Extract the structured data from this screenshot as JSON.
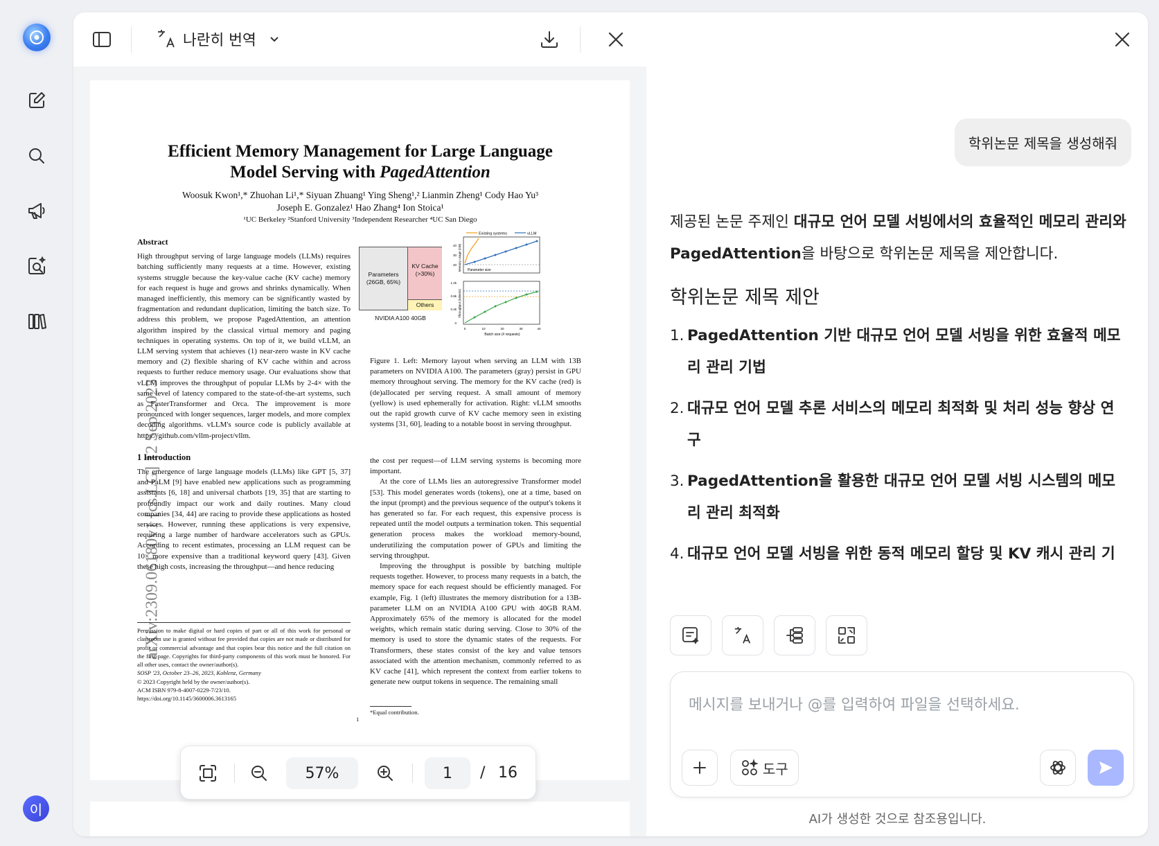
{
  "sidebar": {
    "icons": [
      "logo-icon",
      "new-chat-icon",
      "search-icon",
      "megaphone-icon",
      "image-search-icon",
      "library-icon"
    ],
    "avatar_label": "이"
  },
  "viewer": {
    "mode_label": "나란히 번역",
    "zoom": "57%",
    "current_page": "1",
    "page_separator": "/",
    "total_pages": "16"
  },
  "paper": {
    "title_line1": "Efficient Memory Management for Large Language",
    "title_line2a": "Model Serving with ",
    "title_line2b": "PagedAttention",
    "authors_line1": "Woosuk Kwon¹,* Zhuohan Li¹,* Siyuan Zhuang¹ Ying Sheng¹,² Lianmin Zheng¹ Cody Hao Yu³",
    "authors_line2": "Joseph E. Gonzalez¹ Hao Zhang⁴ Ion Stoica¹",
    "affiliations": "¹UC Berkeley ²Stanford University ³Independent Researcher ⁴UC San Diego",
    "arxiv_id": "arXiv:2309.06180v1 [cs.LG] 12 Sep 2023",
    "abstract_heading": "Abstract",
    "abstract_text": "High throughput serving of large language models (LLMs) requires batching sufficiently many requests at a time. However, existing systems struggle because the key-value cache (KV cache) memory for each request is huge and grows and shrinks dynamically. When managed inefficiently, this memory can be significantly wasted by fragmentation and redundant duplication, limiting the batch size. To address this problem, we propose PagedAttention, an attention algorithm inspired by the classical virtual memory and paging techniques in operating systems. On top of it, we build vLLM, an LLM serving system that achieves (1) near-zero waste in KV cache memory and (2) flexible sharing of KV cache within and across requests to further reduce memory usage. Our evaluations show that vLLM improves the throughput of popular LLMs by 2-4× with the same level of latency compared to the state-of-the-art systems, such as FasterTransformer and Orca. The improvement is more pronounced with longer sequences, larger models, and more complex decoding algorithms. vLLM's source code is publicly available at https://github.com/vllm-project/vllm.",
    "intro_heading": "1 Introduction",
    "intro_text": "The emergence of large language models (LLMs) like GPT [5, 37] and PaLM [9] have enabled new applications such as programming assistants [6, 18] and universal chatbots [19, 35] that are starting to profoundly impact our work and daily routines. Many cloud companies [34, 44] are racing to provide these applications as hosted services. However, running these applications is very expensive, requiring a large number of hardware accelerators such as GPUs. According to recent estimates, processing an LLM request can be 10× more expensive than a traditional keyword query [43]. Given these high costs, increasing the throughput—and hence reducing",
    "footnote_permission": "Permission to make digital or hard copies of part or all of this work for personal or classroom use is granted without fee provided that copies are not made or distributed for profit or commercial advantage and that copies bear this notice and the full citation on the first page. Copyrights for third-party components of this work must be honored. For all other uses, contact the owner/author(s).",
    "footnote_venue": "SOSP '23, October 23–26, 2023, Koblenz, Germany",
    "footnote_copyright": "© 2023 Copyright held by the owner/author(s).",
    "footnote_isbn": "ACM ISBN 979-8-4007-0229-7/23/10.",
    "footnote_doi": "https://doi.org/10.1145/3600006.3613165",
    "figure_caption": "Figure 1. Left: Memory layout when serving an LLM with 13B parameters on NVIDIA A100. The parameters (gray) persist in GPU memory throughout serving. The memory for the KV cache (red) is (de)allocated per serving request. A small amount of memory (yellow) is used ephemerally for activation. Right: vLLM smooths out the rapid growth curve of KV cache memory seen in existing systems [31, 60], leading to a notable boost in serving throughput.",
    "right_col_text1": "the cost per request—of LLM serving systems is becoming more important.",
    "right_col_text2": "At the core of LLMs lies an autoregressive Transformer model [53]. This model generates words (tokens), one at a time, based on the input (prompt) and the previous sequence of the output's tokens it has generated so far. For each request, this expensive process is repeated until the model outputs a termination token. This sequential generation process makes the workload memory-bound, underutilizing the computation power of GPUs and limiting the serving throughput.",
    "right_col_text3": "Improving the throughput is possible by batching multiple requests together. However, to process many requests in a batch, the memory space for each request should be efficiently managed. For example, Fig. 1 (left) illustrates the memory distribution for a 13B-parameter LLM on an NVIDIA A100 GPU with 40GB RAM. Approximately 65% of the memory is allocated for the model weights, which remain static during serving. Close to 30% of the memory is used to store the dynamic states of the requests. For Transformers, these states consist of the key and value tensors associated with the attention mechanism, commonly referred to as KV cache [41], which represent the context from earlier tokens to generate new output tokens in sequence. The remaining small",
    "equal_contribution": "*Equal contribution.",
    "page_number": "1",
    "fig_params": "Parameters (26GB, 65%)",
    "fig_kv": "KV Cache (>30%)",
    "fig_others": "Others",
    "fig_gpu": "NVIDIA A100 40GB",
    "fig_legend_existing": "Existing systems",
    "fig_legend_vllm": "vLLM",
    "fig_memory_axis": "Memory usage (GB)",
    "fig_param_size": "Parameter size",
    "fig_throughput_axis": "Throughput (token/s)",
    "fig_batch_axis": "Batch size (# requests)",
    "fig_y_ticks_top": [
      "40",
      "30",
      "20"
    ],
    "fig_y_ticks_bottom": [
      "1.2k",
      "0.8k",
      "0.4k",
      "0"
    ],
    "fig_x_ticks": [
      "0",
      "10",
      "20",
      "30",
      "40"
    ]
  },
  "chat": {
    "user_message": "학위논문 제목을 생성해줘",
    "intro_plain1": "제공된 논문 주제인 ",
    "intro_bold": "대규모 언어 모델 서빙에서의 효율적인 메모리 관리와 PagedAttention",
    "intro_plain2": "을 바탕으로 학위논문 제목을 제안합니다.",
    "heading": "학위논문 제목 제안",
    "items": [
      {
        "num": "1.",
        "text": "PagedAttention 기반 대규모 언어 모델 서빙을 위한 효율적 메모리 관리 기법"
      },
      {
        "num": "2.",
        "text": "대규모 언어 모델 추론 서비스의 메모리 최적화 및 처리 성능 향상 연구"
      },
      {
        "num": "3.",
        "text": "PagedAttention을 활용한 대규모 언어 모델 서빙 시스템의 메모리 관리 최적화"
      },
      {
        "num": "4.",
        "text": "대규모 언어 모델 서빙을 위한 동적 메모리 할당 및 KV 캐시 관리 기법"
      }
    ],
    "input_placeholder": "메시지를 보내거나 @를 입력하여 파일을 선택하세요.",
    "tools_label": "도구",
    "disclaimer": "AI가 생성한 것으로 참조용입니다."
  },
  "colors": {
    "accent": "#a9b8ff",
    "avatar": "#4a55e8",
    "kv_cache": "#f4c5c8",
    "params": "#e8e8e8",
    "others": "#fff3b5",
    "existing_line": "#f39c12",
    "vllm_line": "#2e6db8",
    "throughput_line": "#3aa34a"
  }
}
